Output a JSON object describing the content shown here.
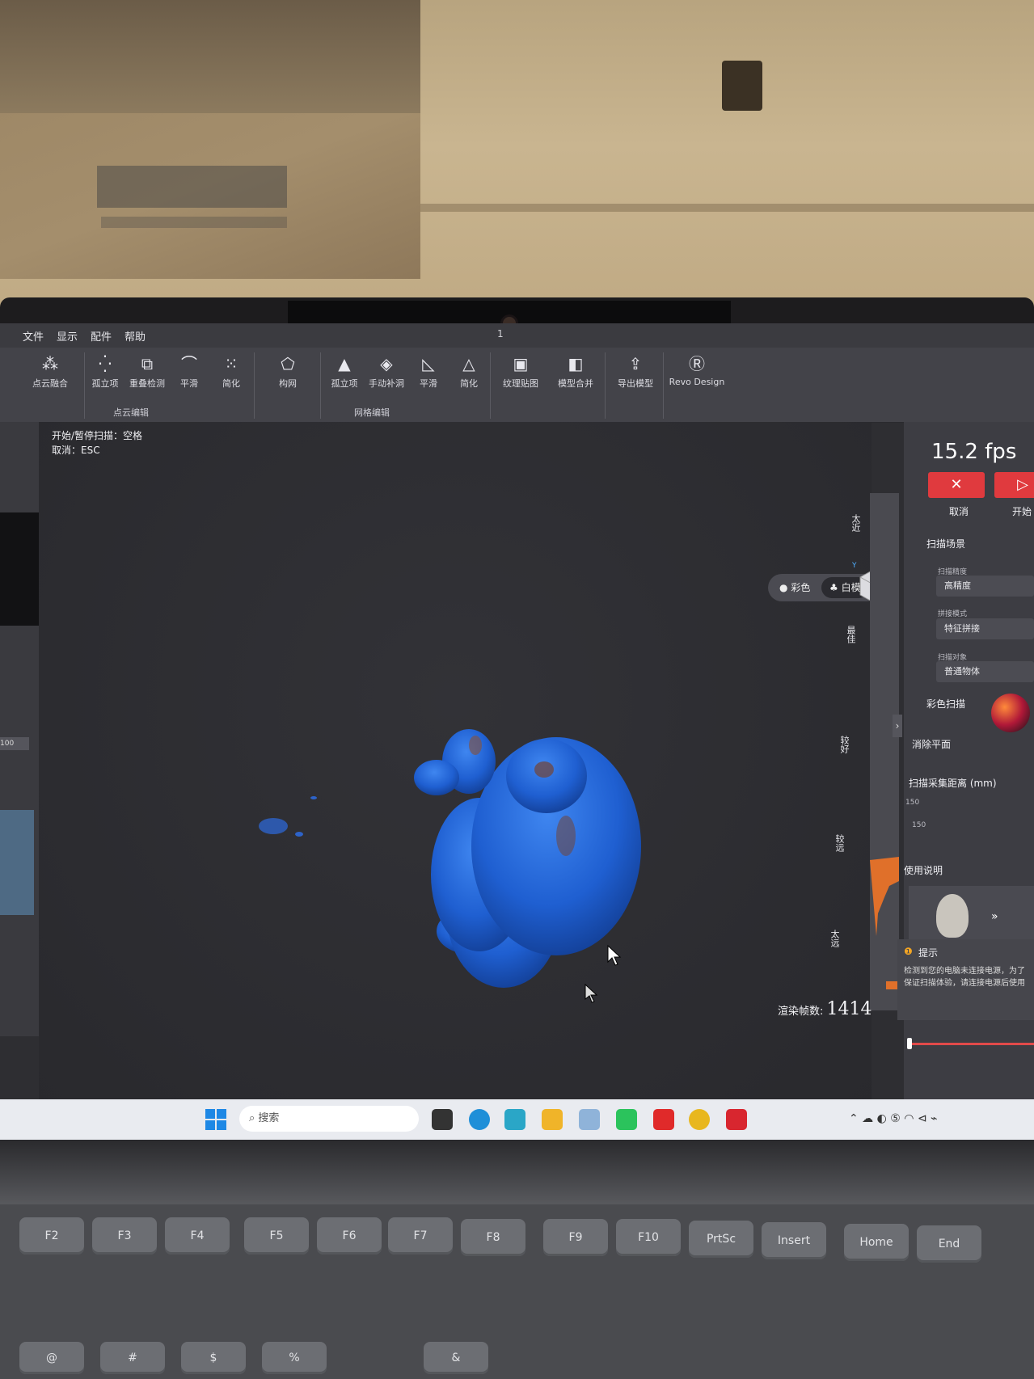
{
  "menu": {
    "file": "文件",
    "view": "显示",
    "config": "配件",
    "help": "帮助",
    "window_title": "1"
  },
  "ribbon": {
    "pointcloud": {
      "merge": "点云融合",
      "isolate": "孤立项",
      "overlap": "重叠检测",
      "smooth": "平滑",
      "simplify": "简化",
      "group": "点云编辑"
    },
    "mesh": {
      "build": "构网",
      "isolate": "孤立项",
      "fill": "手动补洞",
      "smooth": "平滑",
      "simplify": "简化",
      "group": "网格编辑"
    },
    "texture": "纹理贴图",
    "merge_model": "模型合并",
    "export": "导出模型",
    "revo": "Revo Design"
  },
  "viewport": {
    "hint_scan": "开始/暂停扫描：空格",
    "hint_cancel": "取消：ESC",
    "mode_color": "彩色",
    "mode_white": "白模",
    "depth_labels": [
      "太近",
      "最佳",
      "较好",
      "较远",
      "太远"
    ],
    "render_fps_label": "渲染帧数:",
    "render_fps_value": "1414"
  },
  "side": {
    "fps": "15.2 fps",
    "cancel": "取消",
    "start": "开始",
    "section_scene": "扫描场景",
    "precision_label": "扫描精度",
    "precision_value": "高精度",
    "stitch_label": "拼接模式",
    "stitch_value": "特征拼接",
    "object_label": "扫描对象",
    "object_value": "普通物体",
    "color_scan": "彩色扫描",
    "remove_plane": "消除平面",
    "distance_label": "扫描采集距离 (mm)",
    "distance_max": "150",
    "distance_min": "150",
    "instructions": "使用说明",
    "tip_title": "提示",
    "tip_text": "检测到您的电脑未连接电源，为了保证扫描体验，请连接电源后使用",
    "left_num": "100"
  },
  "taskbar": {
    "search": "搜索"
  },
  "keys": [
    "F2",
    "F3",
    "F4",
    "F5",
    "F6",
    "F7",
    "F8",
    "F9",
    "F10",
    "PrtSc",
    "Insert",
    "Home",
    "End"
  ],
  "colors": {
    "scan_blue": "#1f5fd1",
    "cancel_red": "#e03a3e",
    "panel": "#3d3d43"
  }
}
